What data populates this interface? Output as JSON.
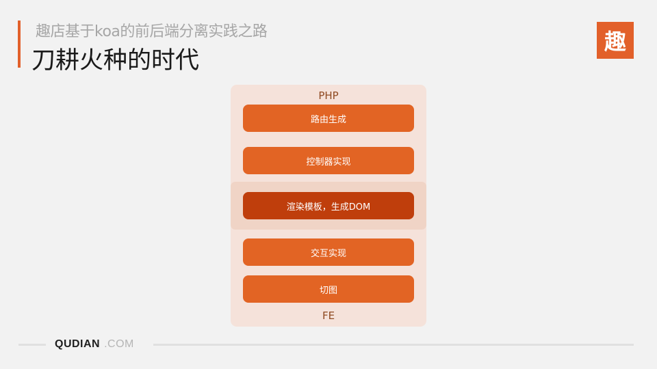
{
  "header": {
    "subtitle": "趣店基于koa的前后端分离实践之路",
    "title": "刀耕火种的时代",
    "logo_char": "趣",
    "accent_color": "#e2602a"
  },
  "diagram": {
    "top_label": "PHP",
    "bottom_label": "FE",
    "steps": [
      {
        "label": "路由生成",
        "highlighted": false
      },
      {
        "label": "控制器实现",
        "highlighted": false
      },
      {
        "label": "渲染模板，生成DOM",
        "highlighted": true
      },
      {
        "label": "交互实现",
        "highlighted": false
      },
      {
        "label": "切图",
        "highlighted": false
      }
    ]
  },
  "footer": {
    "brand_name": "QUDIAN",
    "brand_domain": ".COM"
  }
}
